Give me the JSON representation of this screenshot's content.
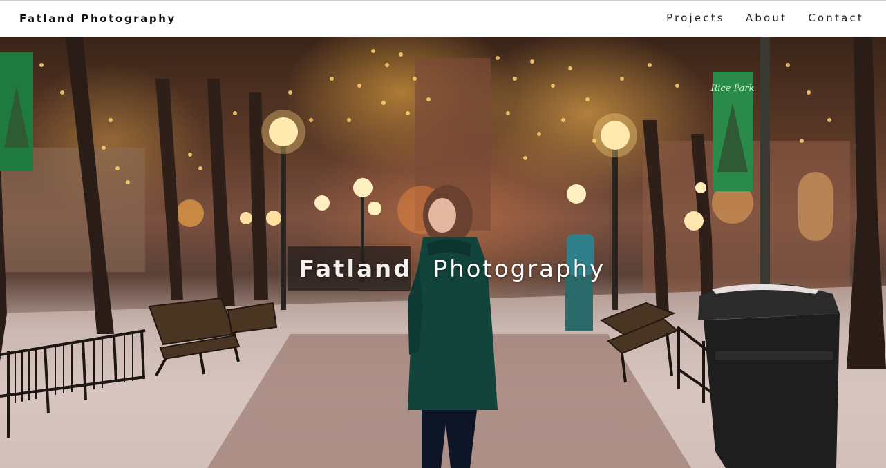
{
  "navbar": {
    "brand": "Fatland Photography",
    "links": [
      "Projects",
      "About",
      "Contact"
    ]
  },
  "hero": {
    "title_word1": "Fatland",
    "title_word2": "Photography",
    "image_description_icon": "winter-park-photo",
    "banner_text": "Rice Park"
  },
  "colors": {
    "navbar_bg": "#ffffff",
    "coat": "#13443c",
    "title_box": "#28201e"
  }
}
